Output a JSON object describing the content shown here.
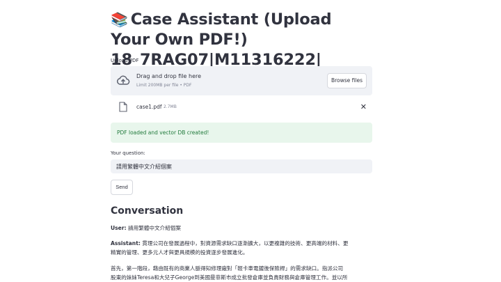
{
  "page": {
    "title_emoji": "📚",
    "title": "Case Assistant (Upload Your Own PDF!) 18_7RAG07|M11316222|"
  },
  "upload": {
    "label": "Upload PDF",
    "drop_text": "Drag and drop file here",
    "limit_text": "Limit 200MB per file • PDF",
    "browse_label": "Browse files"
  },
  "file": {
    "name": "case1.pdf",
    "size": "2.7MB",
    "remove_glyph": "✕"
  },
  "status": {
    "message": "PDF loaded and vector DB created!",
    "color": "#217a3c"
  },
  "question": {
    "label": "Your question:",
    "value": "請用繁體中文介紹個案"
  },
  "send": {
    "label": "Send"
  },
  "conversation": {
    "title": "Conversation",
    "user_label": "User:",
    "user_text": "請用繁體中文介紹個案",
    "assistant_label": "Assistant:",
    "assistant_line1": "貫理公司在發展過程中，對資源需求缺口逐漸擴大，以更複雜的技術、更高端的材料、更",
    "assistant_line2": "精實的管理、更多元人才與更具規模的投資逐步發展進化。",
    "para2_line1": "首先，第一階段，藉由既有的商業人脈得知修理廠對「輕卡車電鍍後保險桿」的需求缺口。指派公司",
    "para2_line2": "股東的妹妹Teresa和大兒子George到美國曼菲斯市成立批發倉庫並負責財務與倉庫管理工作。並以所"
  },
  "colors": {
    "panel_bg": "#f0f2f6",
    "success_bg": "#e8f6ec",
    "text": "#31333f"
  }
}
